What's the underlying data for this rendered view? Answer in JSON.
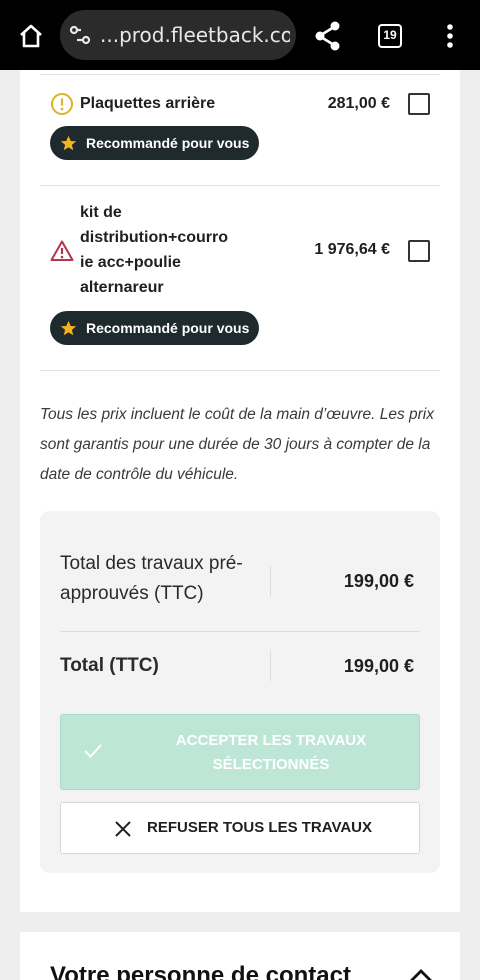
{
  "browser": {
    "url": "...prod.fleetback.com",
    "tab_count": "19",
    "icons": [
      "home-icon",
      "site-settings-icon",
      "share-icon",
      "tab-switcher-icon",
      "more-vert-icon"
    ]
  },
  "items": [
    {
      "name": "Plaquettes arrière",
      "price": "281,00 €",
      "severity": "warning",
      "severity_color": "#d9b42a",
      "badge": "Recommandé pour vous",
      "checked": false
    },
    {
      "name": "kit de distribution+courroie acc+poulie alternareur",
      "name_lines": [
        "kit de",
        "distribution+courro",
        "ie acc+poulie",
        "alternareur"
      ],
      "price": "1 976,64 €",
      "severity": "danger",
      "severity_color": "#b5334e",
      "badge": "Recommandé pour vous",
      "checked": false
    }
  ],
  "note": "Tous les prix incluent le coût de la main d’œuvre. Les prix sont garantis pour une durée de 30 jours à compter de la date de contrôle du véhicule.",
  "summary": {
    "preapproved_label_line1": "Total des travaux pré-",
    "preapproved_label_line2": "approuvés (TTC)",
    "preapproved_value": "199,00 €",
    "total_label": "Total (TTC)",
    "total_value": "199,00 €"
  },
  "actions": {
    "accept_line1": "ACCEPTER LES TRAVAUX",
    "accept_line2": "SÉLECTIONNÉS",
    "accept_disabled": true,
    "refuse": "REFUSER TOUS LES TRAVAUX"
  },
  "contact": {
    "title": "Votre personne de contact"
  },
  "colors": {
    "badge_bg": "#1f2a2e",
    "star": "#f5b21b",
    "accept_bg": "#bde6d7"
  }
}
